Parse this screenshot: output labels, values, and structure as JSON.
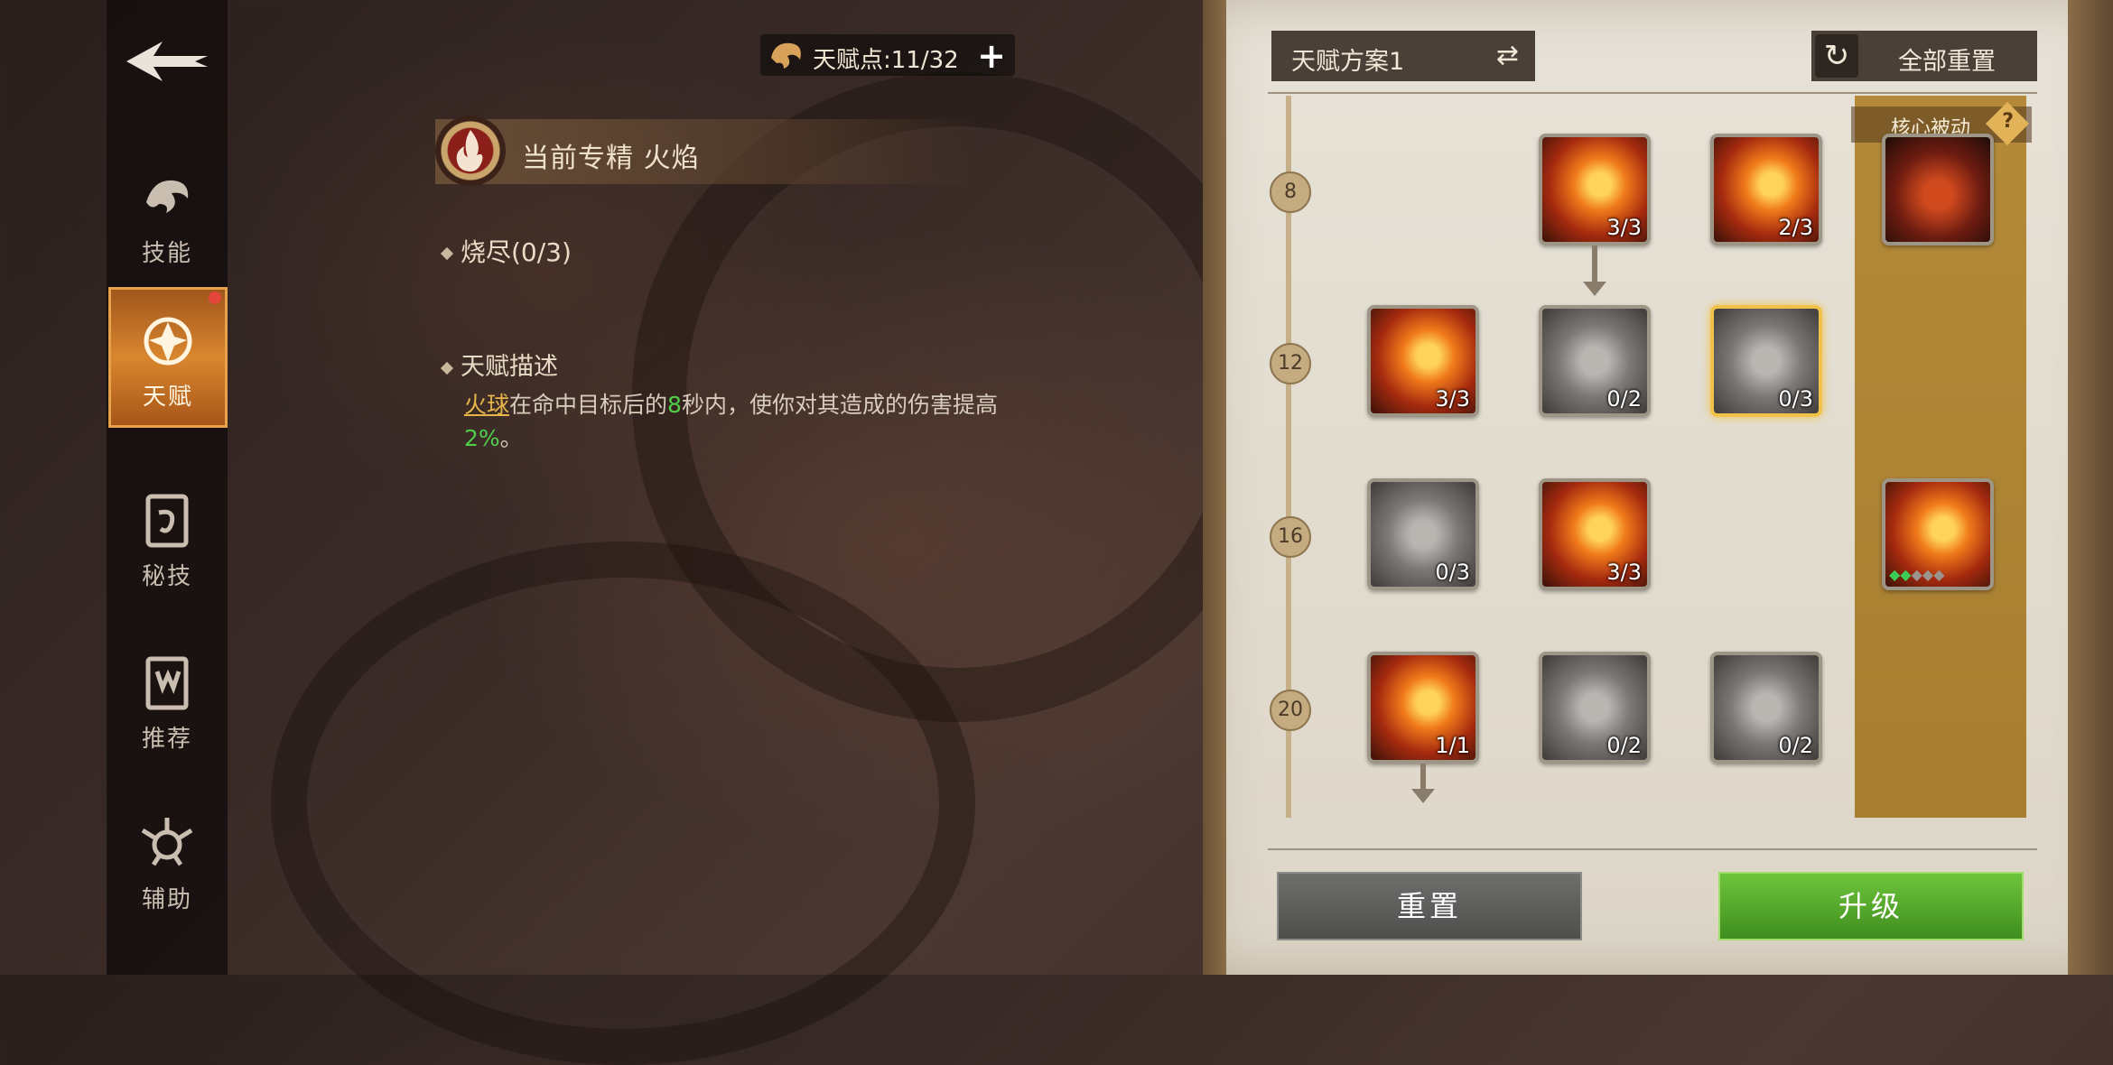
{
  "nav": {
    "items": [
      {
        "label": "技能",
        "icon": "skill-icon"
      },
      {
        "label": "天赋",
        "icon": "talent-icon",
        "active": true
      },
      {
        "label": "秘技",
        "icon": "secret-skill-icon"
      },
      {
        "label": "推荐",
        "icon": "recommend-icon"
      },
      {
        "label": "辅助",
        "icon": "assist-icon"
      }
    ]
  },
  "header": {
    "talent_points": "天赋点:11/32"
  },
  "spec": {
    "label": "当前专精 火焰"
  },
  "detail": {
    "name": "烧尽(0/3)",
    "desc_title": "天赋描述",
    "desc_keyword": "火球",
    "desc_part1": "在命中目标后的",
    "desc_num": "8",
    "desc_part2": "秒内，使你对其造成的伤害提高",
    "desc_pct": "2%",
    "desc_end": "。"
  },
  "panel": {
    "scheme": "天赋方案1",
    "reset_all": "全部重置",
    "core_passive": "核心被动",
    "levels": [
      "8",
      "12",
      "16",
      "20"
    ],
    "skills": {
      "r8c2": "3/3",
      "r8c3": "2/3",
      "r12c1": "3/3",
      "r12c2": "0/2",
      "r12c3": "0/3",
      "r16c1": "0/3",
      "r16c2": "3/3",
      "r20c1": "1/1",
      "r20c2": "0/2",
      "r20c3": "0/2"
    },
    "reset": "重置",
    "upgrade": "升级"
  },
  "colors": {
    "accent": "#d9862e",
    "highlight": "#e7b54a",
    "green": "#4fcf4a"
  }
}
